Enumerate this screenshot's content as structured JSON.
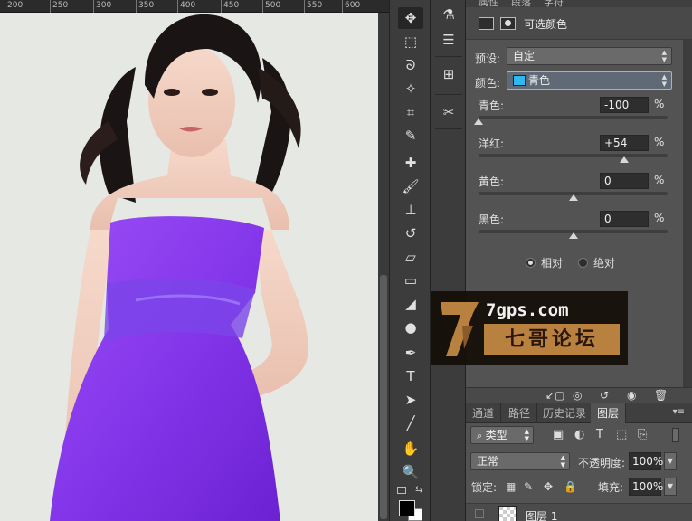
{
  "ruler": {
    "ticks": [
      "200",
      "250",
      "300",
      "350",
      "400",
      "450",
      "500",
      "550",
      "600"
    ]
  },
  "properties": {
    "tabs": [
      "属性",
      "段落",
      "字符"
    ],
    "title": "可选颜色",
    "preset": {
      "label": "预设:",
      "value": "自定"
    },
    "color": {
      "label": "颜色:",
      "value": "青色",
      "swatch": "#2fb9f3"
    },
    "sliders": [
      {
        "label": "青色:",
        "value": "-100",
        "unit": "%",
        "position": 0.0
      },
      {
        "label": "洋红:",
        "value": "+54",
        "unit": "%",
        "position": 0.77
      },
      {
        "label": "黄色:",
        "value": "0",
        "unit": "%",
        "position": 0.5
      },
      {
        "label": "黑色:",
        "value": "0",
        "unit": "%",
        "position": 0.5
      }
    ],
    "methods": [
      {
        "label": "相对",
        "selected": true
      },
      {
        "label": "绝对",
        "selected": false
      }
    ]
  },
  "watermark": {
    "url": "7gps.com",
    "name": "七哥论坛"
  },
  "layers": {
    "tabs": [
      "通道",
      "路径",
      "历史记录",
      "图层"
    ],
    "active_tab": "图层",
    "filter": {
      "value": "类型"
    },
    "blend_mode": {
      "value": "正常"
    },
    "opacity": {
      "label": "不透明度:",
      "value": "100%"
    },
    "lock": {
      "label": "锁定:"
    },
    "fill": {
      "label": "填充:",
      "value": "100%"
    },
    "layer_name": "图层 1"
  },
  "colors": {
    "dress": "#8a3cf0",
    "panel_bg": "#535353",
    "tool_bg": "#3c3c3c"
  }
}
